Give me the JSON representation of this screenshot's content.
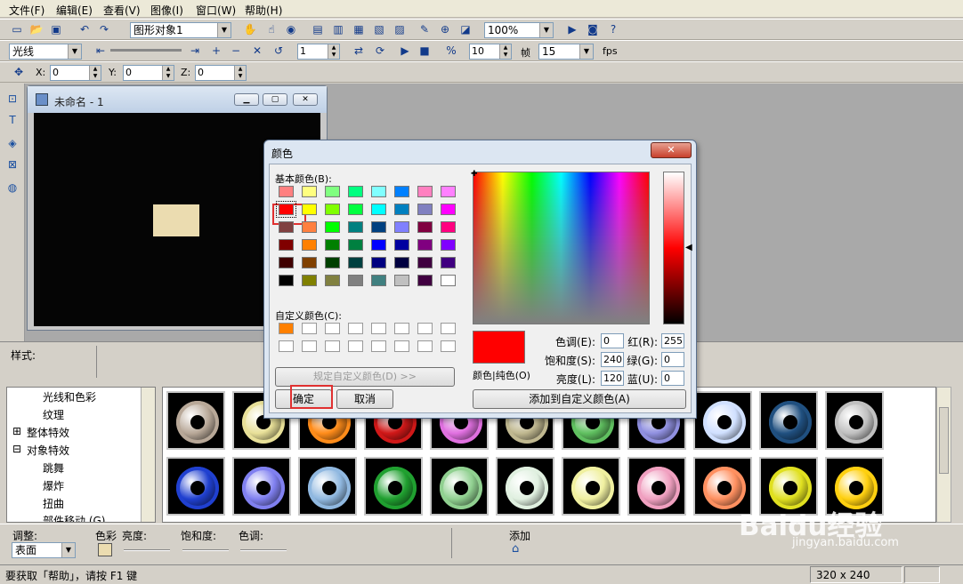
{
  "menu": [
    "文件(F)",
    "编辑(E)",
    "查看(V)",
    "图像(I)",
    "窗口(W)",
    "帮助(H)"
  ],
  "toolbar1": {
    "object_combo": "图形对象1",
    "zoom_combo": "100%"
  },
  "toolbar2": {
    "light_combo": "光线",
    "frame_value": "1",
    "speed_value": "10",
    "frame_label": "帧",
    "fps_value": "15",
    "fps_label": "fps"
  },
  "toolbar3": {
    "x_label": "X:",
    "x_value": "0",
    "y_label": "Y:",
    "y_value": "0",
    "z_label": "Z:",
    "z_value": "0"
  },
  "doc": {
    "title": "未命名 - 1",
    "canvas_bg": "#050505",
    "rect_color": "#ebdcb0"
  },
  "style_label": "样式:",
  "tree": [
    "光线和色彩",
    "纹理",
    "整体特效",
    "对象特效",
    "跳舞",
    "爆炸",
    "扭曲",
    "部件移动 (G)"
  ],
  "dialog": {
    "title": "颜色",
    "basic_label": "基本颜色(B):",
    "custom_label": "自定义颜色(C):",
    "define_btn": "规定自定义颜色(D) >>",
    "ok_btn": "确定",
    "cancel_btn": "取消",
    "solid_label": "颜色|纯色(O)",
    "add_btn": "添加到自定义颜色(A)",
    "hue_label": "色调(E):",
    "hue_value": "0",
    "sat_label": "饱和度(S):",
    "sat_value": "240",
    "lum_label": "亮度(L):",
    "lum_value": "120",
    "red_label": "红(R):",
    "red_value": "255",
    "green_label": "绿(G):",
    "green_value": "0",
    "blue_label": "蓝(U):",
    "blue_value": "0",
    "selected_color": "#ff0000",
    "basic_colors": [
      [
        "#ff8080",
        "#ffff80",
        "#80ff80",
        "#00ff80",
        "#80ffff",
        "#0080ff",
        "#ff80c0",
        "#ff80ff"
      ],
      [
        "#ff0000",
        "#ffff00",
        "#80ff00",
        "#00ff40",
        "#00ffff",
        "#0080c0",
        "#8080c0",
        "#ff00ff"
      ],
      [
        "#804040",
        "#ff8040",
        "#00ff00",
        "#008080",
        "#004080",
        "#8080ff",
        "#800040",
        "#ff0080"
      ],
      [
        "#800000",
        "#ff8000",
        "#008000",
        "#008040",
        "#0000ff",
        "#0000a0",
        "#800080",
        "#8000ff"
      ],
      [
        "#400000",
        "#804000",
        "#004000",
        "#004040",
        "#000080",
        "#000040",
        "#400040",
        "#400080"
      ],
      [
        "#000000",
        "#808000",
        "#808040",
        "#808080",
        "#408080",
        "#c0c0c0",
        "#400040",
        "#ffffff"
      ]
    ],
    "custom_first": "#ff8000"
  },
  "bottom": {
    "adjust_label": "调整:",
    "surface_combo": "表面",
    "color_label": "色彩",
    "brightness_label": "亮度:",
    "saturation_label": "饱和度:",
    "hue_label": "色调:",
    "add_label": "添加"
  },
  "status": {
    "help_text": "要获取「帮助」，请按 F1 键",
    "size": "320 x 240"
  },
  "gear_colors": [
    [
      "#b8a898",
      "#e8e098",
      "#ff8c1a",
      "#d01818",
      "#e070e0",
      "#c0b890",
      "#60c060",
      "#9090e0",
      "#d0e0ff",
      "#205080",
      "#c0c0c0"
    ],
    [
      "#2040d0",
      "#8080f0",
      "#90b8e0",
      "#20a030",
      "#90d090",
      "#e0f0e0",
      "#f0f0a0",
      "#f0a0c0",
      "#ff9060",
      "#e0e020",
      "#ffd010"
    ]
  ],
  "watermark": {
    "brand": "Baidu经验",
    "url": "jingyan.baidu.com"
  }
}
